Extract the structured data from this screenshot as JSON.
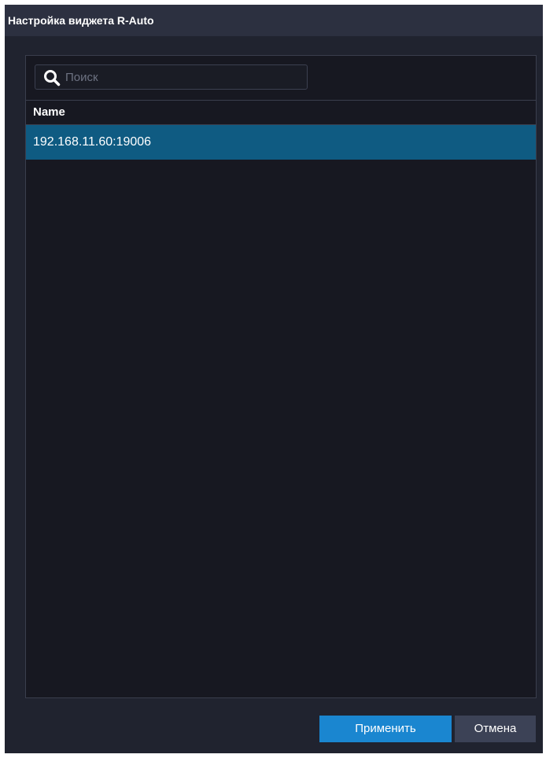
{
  "window": {
    "title": "Настройка виджета R-Auto"
  },
  "search": {
    "placeholder": "Поиск",
    "value": "",
    "icon": "search-icon"
  },
  "table": {
    "columns": [
      "Name"
    ],
    "rows": [
      {
        "name": "192.168.11.60:19006",
        "selected": true
      }
    ]
  },
  "buttons": {
    "apply_label": "Применить",
    "cancel_label": "Отмена"
  },
  "colors": {
    "titlebar": "#2c3040",
    "background": "#20232f",
    "panel": "#171821",
    "selection": "#0f5b82",
    "primary_button": "#1a86d0",
    "secondary_button": "#3c4256"
  }
}
